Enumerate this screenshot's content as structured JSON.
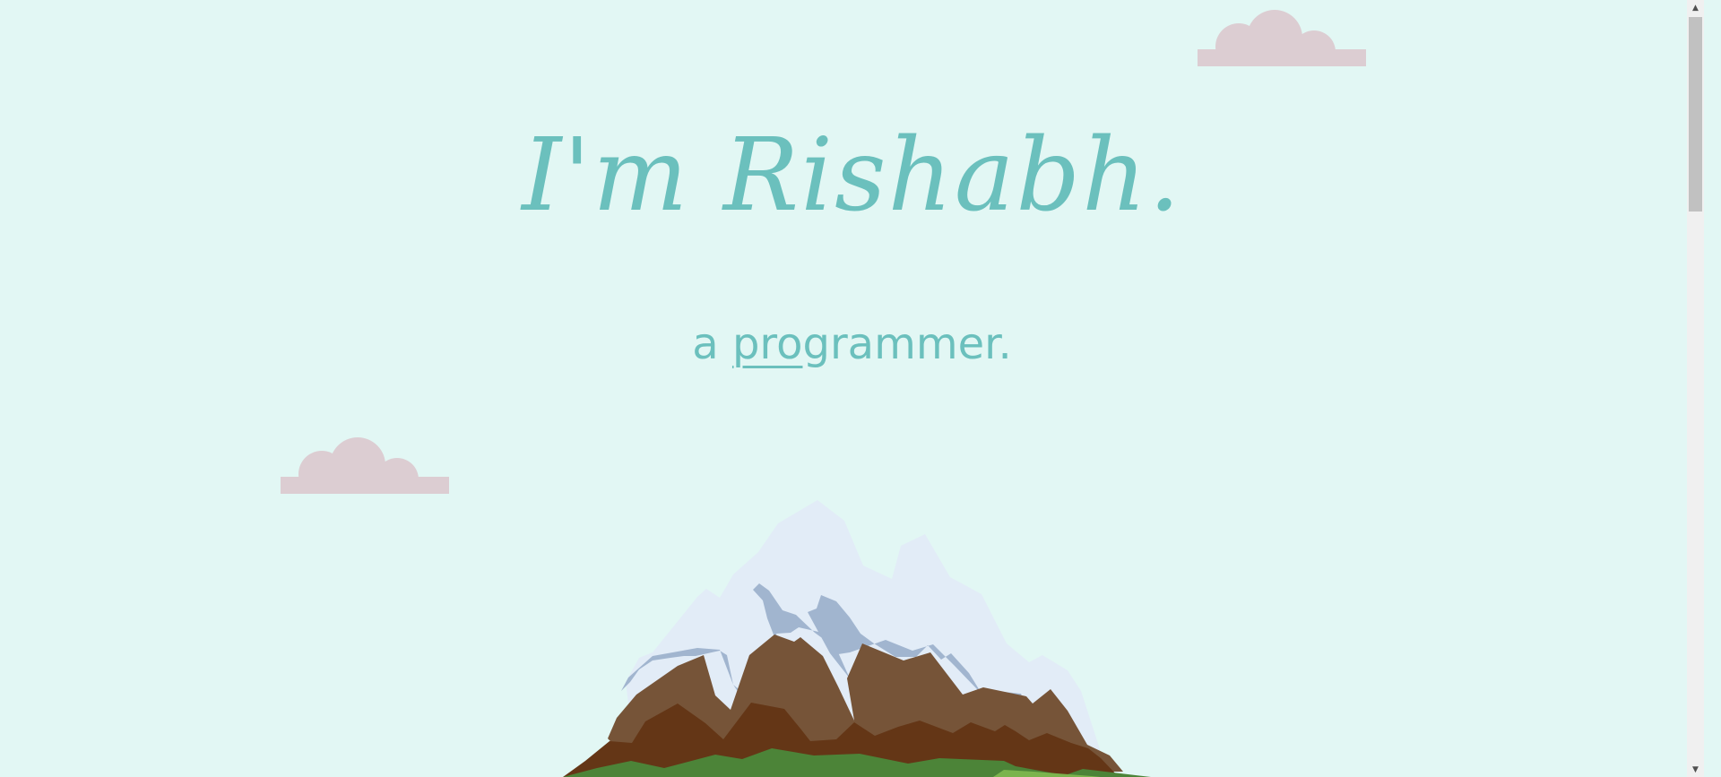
{
  "hero": {
    "title": "I'm Rishabh.",
    "subtitle_prefix": "a ",
    "subtitle_underlined": "pro",
    "subtitle_rest": "grammer."
  },
  "colors": {
    "background": "#e2f7f4",
    "accent": "#6bc0bd",
    "cloud": "#dccdd2",
    "snow": "#e2ecf7",
    "snow_shadow": "#a1b5cf",
    "rock": "#765438",
    "rock_dark": "#643616",
    "grass": "#4c8438",
    "grass_light": "#7bb44d"
  },
  "scrollbar": {
    "up_icon": "▲",
    "down_icon": "▼"
  }
}
